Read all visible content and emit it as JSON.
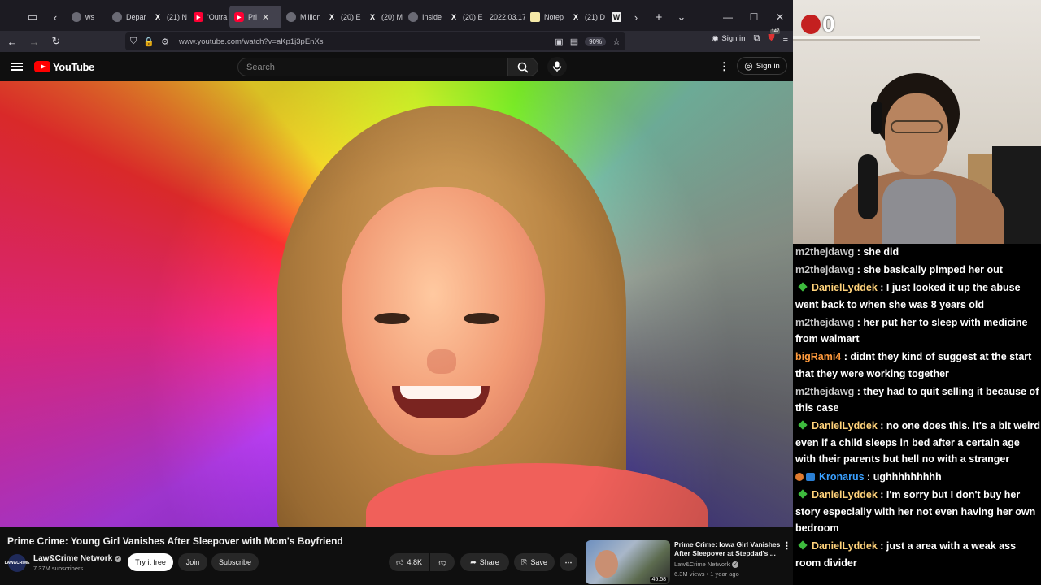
{
  "browser": {
    "tabs": [
      {
        "icon": "back-arrow",
        "label": "ws",
        "type": "gen"
      },
      {
        "label": "Depar",
        "type": "gen"
      },
      {
        "label": "(21) N",
        "type": "x"
      },
      {
        "label": "'Outra",
        "type": "yt"
      },
      {
        "label": "Pri",
        "type": "yt",
        "active": true
      },
      {
        "label": "Million",
        "type": "gen"
      },
      {
        "label": "(20) E",
        "type": "x"
      },
      {
        "label": "(20) M",
        "type": "x"
      },
      {
        "label": "Inside",
        "type": "gen"
      },
      {
        "label": "(20) E",
        "type": "x"
      },
      {
        "label": "2022.03.17",
        "type": "none"
      },
      {
        "label": "Notep",
        "type": "note"
      },
      {
        "label": "(21) D",
        "type": "x"
      },
      {
        "label": "",
        "type": "w"
      }
    ],
    "url": "www.youtube.com/watch?v=aKp1j3pEnXs",
    "zoom": "90%",
    "signin_label": "Sign in",
    "notification_count": "147"
  },
  "youtube": {
    "logo_text": "YouTube",
    "search_placeholder": "Search",
    "signin_label": "Sign in",
    "video": {
      "title": "Prime Crime: Young Girl Vanishes After Sleepover with Mom's Boyfriend",
      "channel": "Law&Crime Network",
      "channel_avatar_text": "LAW&CRIME",
      "subscribers": "7.37M subscribers",
      "try_label": "Try it free",
      "join_label": "Join",
      "subscribe_label": "Subscribe",
      "likes": "4.8K",
      "share_label": "Share",
      "save_label": "Save"
    },
    "recommended": {
      "title": "Prime Crime: Iowa Girl Vanishes After Sleepover at Stepdad's ...",
      "channel": "Law&Crime Network",
      "duration": "45:58",
      "meta": "6.3M views • 1 year ago"
    }
  },
  "webcam": {
    "counter": "0"
  },
  "chat": {
    "messages": [
      {
        "user": "m2thejdawg",
        "color": "#c8c8c8",
        "badge": "none",
        "text": "she did"
      },
      {
        "user": "m2thejdawg",
        "color": "#c8c8c8",
        "badge": "none",
        "text": "she basically pimped her out"
      },
      {
        "user": "DanielLyddek",
        "color": "#ffd27a",
        "badge": "gem",
        "text": "I just looked it up the abuse went back to when she was 8 years old"
      },
      {
        "user": "m2thejdawg",
        "color": "#c8c8c8",
        "badge": "none",
        "text": "her put her to sleep with medicine from walmart"
      },
      {
        "user": "bigRami4",
        "color": "#ff9a3c",
        "badge": "none",
        "text": "didnt they kind of suggest at the start that they were working together"
      },
      {
        "user": "m2thejdawg",
        "color": "#c8c8c8",
        "badge": "none",
        "text": "they had to quit selling it because of this case"
      },
      {
        "user": "DanielLyddek",
        "color": "#ffd27a",
        "badge": "gem",
        "text": "no one does this. it's a bit weird even if a child sleeps in bed after a certain age with their parents but hell no with a stranger"
      },
      {
        "user": "Kronarus",
        "color": "#3aa0ff",
        "badge": "sub",
        "text": "ughhhhhhhhh"
      },
      {
        "user": "DanielLyddek",
        "color": "#ffd27a",
        "badge": "gem",
        "text": "I'm sorry but I don't buy her story especially with her not even having her own bedroom"
      },
      {
        "user": "DanielLyddek",
        "color": "#ffd27a",
        "badge": "gem",
        "text": "just a area with a weak ass room divider"
      }
    ]
  }
}
